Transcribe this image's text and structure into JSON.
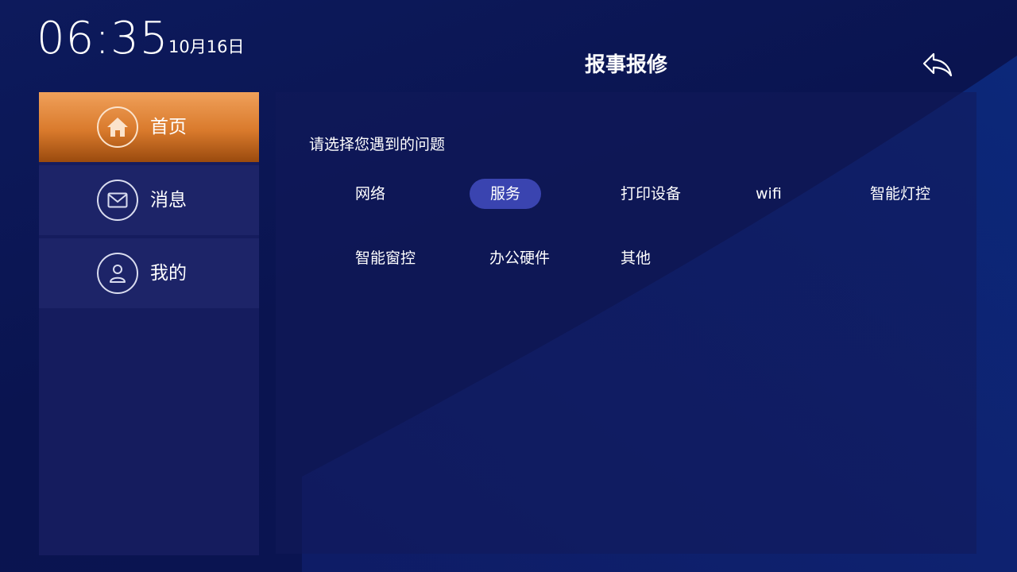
{
  "status": {
    "time": "06:35",
    "date": "10月16日"
  },
  "header": {
    "title": "报事报修"
  },
  "sidebar": {
    "items": [
      {
        "label": "首页",
        "icon": "home-icon",
        "active": true
      },
      {
        "label": "消息",
        "icon": "mail-icon",
        "active": false
      },
      {
        "label": "我的",
        "icon": "user-icon",
        "active": false
      }
    ]
  },
  "main": {
    "prompt": "请选择您遇到的问题",
    "options": [
      {
        "label": "网络",
        "selected": false
      },
      {
        "label": "服务",
        "selected": true
      },
      {
        "label": "打印设备",
        "selected": false
      },
      {
        "label": "wifi",
        "selected": false
      },
      {
        "label": "智能灯控",
        "selected": false
      },
      {
        "label": "智能窗控",
        "selected": false
      },
      {
        "label": "办公硬件",
        "selected": false
      },
      {
        "label": "其他",
        "selected": false
      }
    ]
  },
  "colors": {
    "background": "#0d1a5c",
    "active_nav": "#e08a3c",
    "selected_option": "#3a44b0"
  }
}
